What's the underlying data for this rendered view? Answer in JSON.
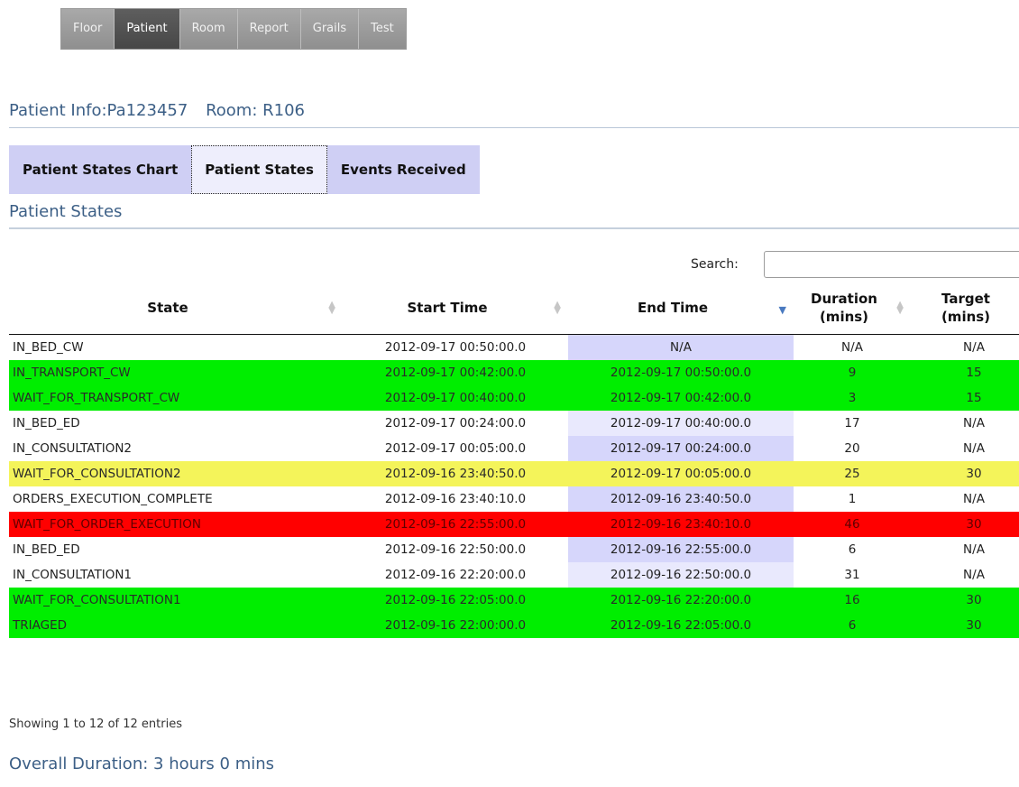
{
  "nav": {
    "items": [
      {
        "label": "Floor"
      },
      {
        "label": "Patient"
      },
      {
        "label": "Room"
      },
      {
        "label": "Report"
      },
      {
        "label": "Grails"
      },
      {
        "label": "Test"
      }
    ],
    "active": "Patient"
  },
  "patient": {
    "info_label": "Patient Info:Pa123457",
    "room_label": "Room: R106"
  },
  "tabs": [
    {
      "label": "Patient States Chart"
    },
    {
      "label": "Patient States"
    },
    {
      "label": "Events Received"
    }
  ],
  "active_tab": "Patient States",
  "section_title": "Patient States",
  "search": {
    "label": "Search:",
    "value": ""
  },
  "table": {
    "headers": {
      "state": "State",
      "start": "Start Time",
      "end": "End Time",
      "duration_line1": "Duration",
      "duration_line2": "(mins)",
      "target_line1": "Target",
      "target_line2": "(mins)"
    },
    "sorted_column": "End Time",
    "sort_direction": "descending",
    "row_colors": {
      "white": "#ffffff",
      "green": "#00ee00",
      "yellow": "#f4f45a",
      "red": "#ff0000"
    },
    "rows": [
      {
        "state": "IN_BED_CW",
        "start": "2012-09-17 00:50:00.0",
        "end": "N/A",
        "duration": "N/A",
        "target": "N/A",
        "status": "white"
      },
      {
        "state": "IN_TRANSPORT_CW",
        "start": "2012-09-17 00:42:00.0",
        "end": "2012-09-17 00:50:00.0",
        "duration": "9",
        "target": "15",
        "status": "green"
      },
      {
        "state": "WAIT_FOR_TRANSPORT_CW",
        "start": "2012-09-17 00:40:00.0",
        "end": "2012-09-17 00:42:00.0",
        "duration": "3",
        "target": "15",
        "status": "green"
      },
      {
        "state": "IN_BED_ED",
        "start": "2012-09-17 00:24:00.0",
        "end": "2012-09-17 00:40:00.0",
        "duration": "17",
        "target": "N/A",
        "status": "white"
      },
      {
        "state": "IN_CONSULTATION2",
        "start": "2012-09-17 00:05:00.0",
        "end": "2012-09-17 00:24:00.0",
        "duration": "20",
        "target": "N/A",
        "status": "white"
      },
      {
        "state": "WAIT_FOR_CONSULTATION2",
        "start": "2012-09-16 23:40:50.0",
        "end": "2012-09-17 00:05:00.0",
        "duration": "25",
        "target": "30",
        "status": "yellow"
      },
      {
        "state": "ORDERS_EXECUTION_COMPLETE",
        "start": "2012-09-16 23:40:10.0",
        "end": "2012-09-16 23:40:50.0",
        "duration": "1",
        "target": "N/A",
        "status": "white"
      },
      {
        "state": "WAIT_FOR_ORDER_EXECUTION",
        "start": "2012-09-16 22:55:00.0",
        "end": "2012-09-16 23:40:10.0",
        "duration": "46",
        "target": "30",
        "status": "red"
      },
      {
        "state": "IN_BED_ED",
        "start": "2012-09-16 22:50:00.0",
        "end": "2012-09-16 22:55:00.0",
        "duration": "6",
        "target": "N/A",
        "status": "white"
      },
      {
        "state": "IN_CONSULTATION1",
        "start": "2012-09-16 22:20:00.0",
        "end": "2012-09-16 22:50:00.0",
        "duration": "31",
        "target": "N/A",
        "status": "white"
      },
      {
        "state": "WAIT_FOR_CONSULTATION1",
        "start": "2012-09-16 22:05:00.0",
        "end": "2012-09-16 22:20:00.0",
        "duration": "16",
        "target": "30",
        "status": "green"
      },
      {
        "state": "TRIAGED",
        "start": "2012-09-16 22:00:00.0",
        "end": "2012-09-16 22:05:00.0",
        "duration": "6",
        "target": "30",
        "status": "green"
      }
    ]
  },
  "info": "Showing 1 to 12 of 12 entries",
  "overall_duration": "Overall Duration: 3 hours 0 mins"
}
